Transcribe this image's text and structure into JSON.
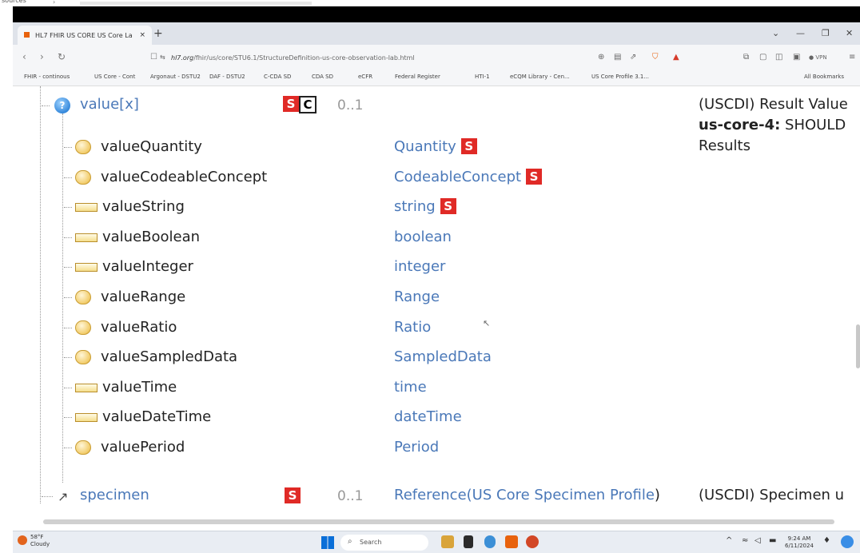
{
  "top_strip": {
    "label": "sources",
    "chev": "›"
  },
  "browser": {
    "tab_title": "HL7 FHIR US CORE US Core La",
    "tab_close": "×",
    "new_tab": "+",
    "window_controls": {
      "menu": "⌄",
      "minimize": "—",
      "maximize": "❐",
      "close": "✕"
    },
    "nav": {
      "back": "‹",
      "forward": "›",
      "reload": "↻",
      "bookmark": "☐"
    },
    "url_prefix": "⇆",
    "url_domain": "hl7.org",
    "url_path": "/fhir/us/core/STU6.1/StructureDefinition-us-core-observation-lab.html",
    "vpn": "● VPN",
    "bookmarks": [
      "FHIR - continous",
      "US Core - Cont",
      "Argonaut - DSTU2",
      "DAF - DSTU2",
      "C-CDA SD",
      "CDA SD",
      "eCFR",
      "Federal Register",
      "HTI-1",
      "eCQM Library - Cen...",
      "US Core Profile 3.1..."
    ],
    "all_bookmarks": "All Bookmarks"
  },
  "page": {
    "header_element": {
      "name": "value[x]",
      "flag_s": "S",
      "flag_c": "C",
      "cardinality": "0..1",
      "desc_line1": "(USCDI) Result Value",
      "desc_bold": "us-core-4:",
      "desc_line2_rest": " SHOULD",
      "desc_line3": "Results"
    },
    "choices": [
      {
        "name": "valueQuantity",
        "type": "Quantity",
        "must_support": "S",
        "icon": "complex-type-icon"
      },
      {
        "name": "valueCodeableConcept",
        "type": "CodeableConcept",
        "must_support": "S",
        "icon": "complex-type-icon"
      },
      {
        "name": "valueString",
        "type": "string",
        "must_support": "S",
        "icon": "primitive-type-icon"
      },
      {
        "name": "valueBoolean",
        "type": "boolean",
        "must_support": "",
        "icon": "primitive-type-icon"
      },
      {
        "name": "valueInteger",
        "type": "integer",
        "must_support": "",
        "icon": "primitive-type-icon"
      },
      {
        "name": "valueRange",
        "type": "Range",
        "must_support": "",
        "icon": "complex-type-icon"
      },
      {
        "name": "valueRatio",
        "type": "Ratio",
        "must_support": "",
        "icon": "complex-type-icon"
      },
      {
        "name": "valueSampledData",
        "type": "SampledData",
        "must_support": "",
        "icon": "complex-type-icon"
      },
      {
        "name": "valueTime",
        "type": "time",
        "must_support": "",
        "icon": "primitive-type-icon"
      },
      {
        "name": "valueDateTime",
        "type": "dateTime",
        "must_support": "",
        "icon": "primitive-type-icon"
      },
      {
        "name": "valuePeriod",
        "type": "Period",
        "must_support": "",
        "icon": "complex-type-icon"
      }
    ],
    "specimen": {
      "name": "specimen",
      "flag_s": "S",
      "cardinality": "0..1",
      "type_prefix": "Reference(",
      "type_target": "US Core Specimen Profile",
      "type_suffix": ")",
      "description": "(USCDI) Specimen u"
    }
  },
  "taskbar": {
    "weather_temp": "58°F",
    "weather_desc": "Cloudy",
    "search_placeholder": "Search",
    "time": "9:24 AM",
    "date": "6/11/2024"
  },
  "colors": {
    "link": "#4a78b8",
    "badge": "#e02a26"
  }
}
